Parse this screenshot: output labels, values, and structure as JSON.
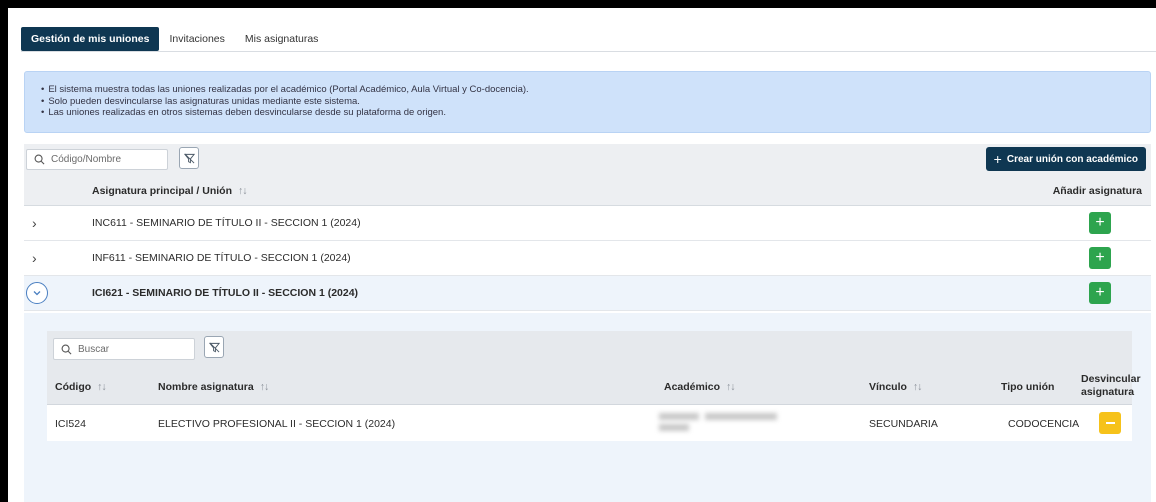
{
  "tabs": [
    {
      "label": "Gestión de mis uniones",
      "active": true
    },
    {
      "label": "Invitaciones",
      "active": false
    },
    {
      "label": "Mis asignaturas",
      "active": false
    }
  ],
  "info": {
    "items": [
      "El sistema muestra todas las uniones realizadas por el académico (Portal Académico, Aula Virtual y Co-docencia).",
      "Solo pueden desvincularse las asignaturas unidas mediante este sistema.",
      "Las uniones realizadas en otros sistemas deben desvincularse desde su plataforma de origen."
    ]
  },
  "toolbar": {
    "search_placeholder": "Código/Nombre",
    "create_label": "Crear unión con académico"
  },
  "table": {
    "col_subject": "Asignatura principal / Unión",
    "col_add": "Añadir asignatura",
    "rows": [
      {
        "label": "INC611 - SEMINARIO DE TÍTULO II - SECCION 1 (2024)",
        "expanded": false
      },
      {
        "label": "INF611 - SEMINARIO DE TÍTULO - SECCION 1 (2024)",
        "expanded": false
      },
      {
        "label": "ICI621 - SEMINARIO DE TÍTULO II - SECCION 1 (2024)",
        "expanded": true
      }
    ]
  },
  "nested": {
    "search_placeholder": "Buscar",
    "headers": {
      "code": "Código",
      "name": "Nombre asignatura",
      "academic": "Académico",
      "link": "Vínculo",
      "type": "Tipo unión",
      "unlink_line1": "Desvincular",
      "unlink_line2": "asignatura"
    },
    "rows": [
      {
        "code": "ICI524",
        "name": "ELECTIVO PROFESIONAL II - SECCION 1 (2024)",
        "link": "SECUNDARIA",
        "type": "CODOCENCIA"
      }
    ]
  },
  "colors": {
    "primary": "#0f3752",
    "add": "#2da44e",
    "remove": "#f6c21a",
    "info_bg": "#cfe2fa"
  }
}
